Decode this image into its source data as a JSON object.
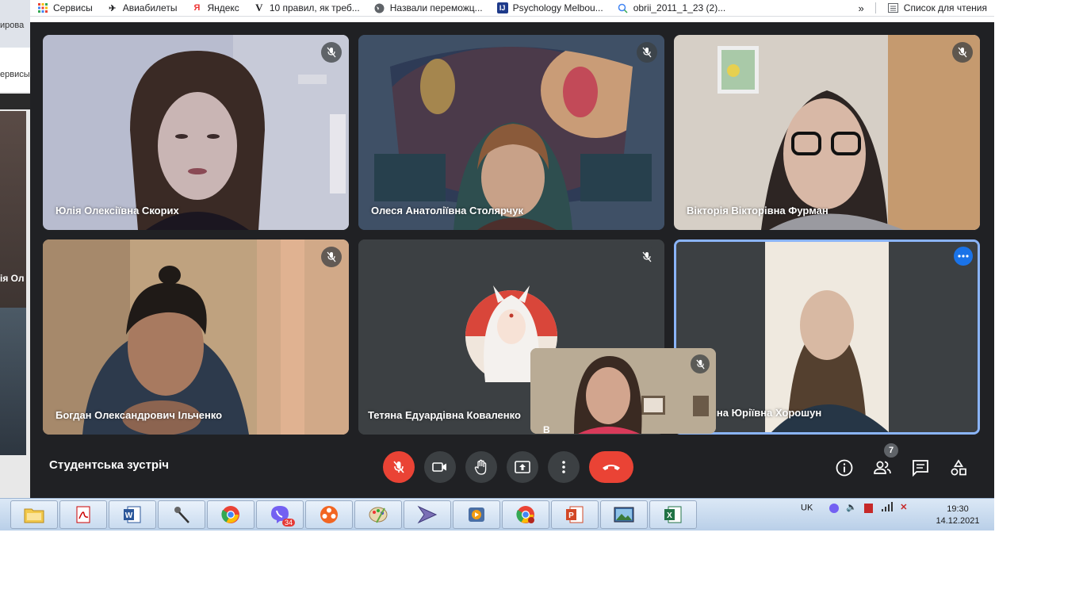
{
  "bookmarks": [
    {
      "label": "Сервисы",
      "icon": "apps-grid-icon"
    },
    {
      "label": "Авиабилеты",
      "icon": "airplane-icon"
    },
    {
      "label": "Яндекс",
      "icon": "yandex-icon"
    },
    {
      "label": "10 правил, як треб...",
      "icon": "v-logo-icon"
    },
    {
      "label": "Назвали переможц...",
      "icon": "globe-icon"
    },
    {
      "label": "Psychology Melbou...",
      "icon": "site-logo-icon"
    },
    {
      "label": "obrii_2011_1_23 (2)...",
      "icon": "search-icon"
    }
  ],
  "bookmarks_more": "»",
  "reading_list": "Список для чтения",
  "left_window": {
    "text_top": "ирова",
    "text_mid": "ервисы",
    "name_fragment": "ія Ол"
  },
  "participants": [
    {
      "name": "Юлія Олексіївна Скорих",
      "muted": true
    },
    {
      "name": "Олеся Анатоліївна Столярчук",
      "muted": true
    },
    {
      "name": "Вікторія Вікторівна Фурман",
      "muted": true
    },
    {
      "name": "Богдан Олександрович Ільченко",
      "muted": true
    },
    {
      "name": "Тетяна Едуардівна Коваленко",
      "muted": true
    },
    {
      "name": "рина Юріївна Хорошун",
      "muted": false
    }
  ],
  "self_preview": {
    "name_fragment": "В"
  },
  "meeting": {
    "title": "Студентська зустріч",
    "participant_count": "7"
  },
  "controls": [
    "mic-off",
    "camera",
    "raise-hand",
    "present",
    "more-options",
    "hang-up"
  ],
  "right_controls": [
    "info",
    "people",
    "chat",
    "activities"
  ],
  "colors": {
    "meet_bg": "#202124",
    "tile_bg": "#3c4043",
    "red": "#ea4335",
    "active_border": "#8ab4f8",
    "more_blue": "#1a73e8"
  },
  "taskbar": {
    "apps": [
      "explorer",
      "pdf-reader",
      "word",
      "microphone",
      "chrome",
      "viber",
      "davinci",
      "paint",
      "player",
      "player2",
      "chrome-alt",
      "powerpoint",
      "photo-viewer",
      "excel"
    ],
    "viber_badge": "34",
    "lang": "UK",
    "time": "19:30",
    "date": "14.12.2021"
  }
}
